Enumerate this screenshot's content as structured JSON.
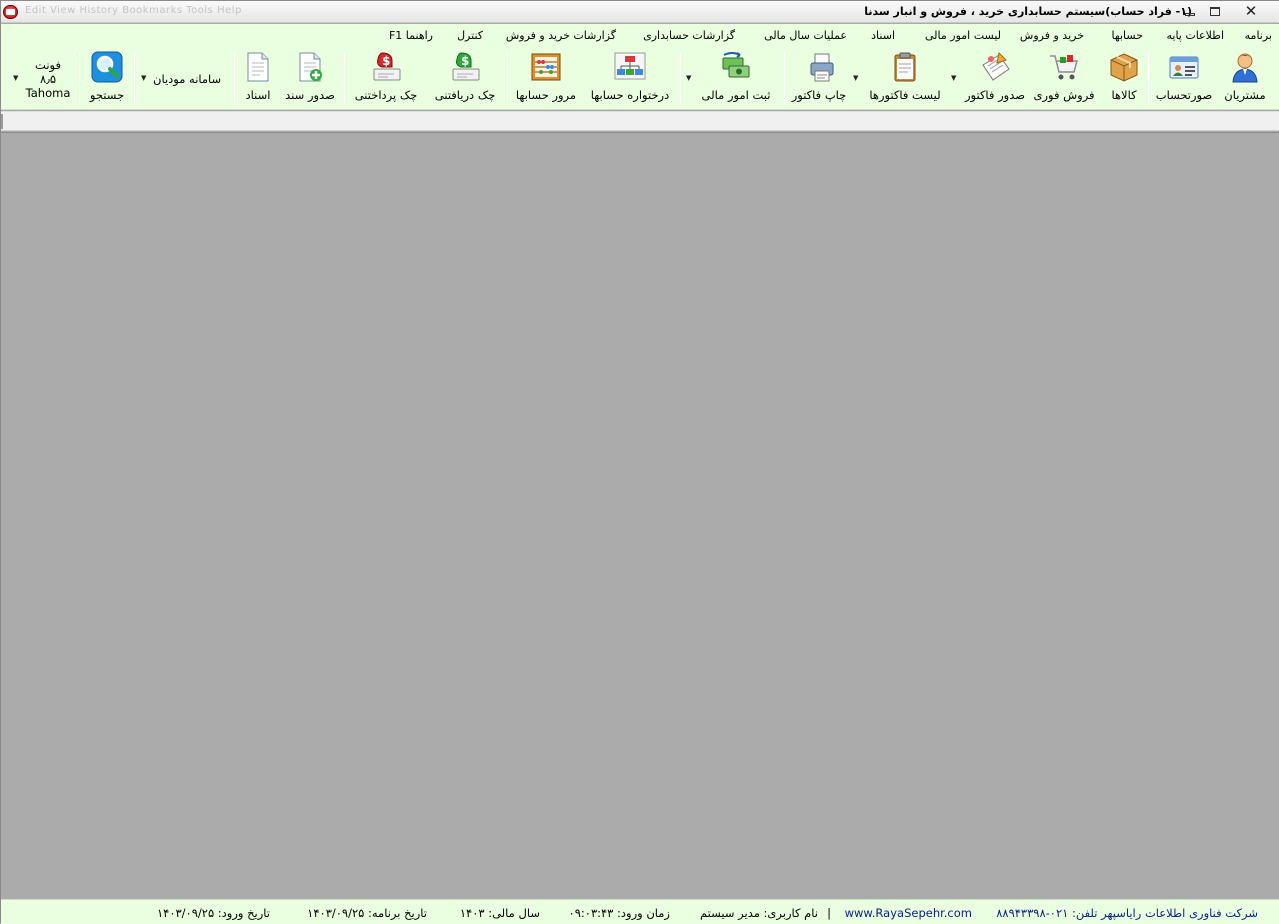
{
  "window": {
    "title": "(۱- فراد حساب)سیستم حسابداری خرید ، فروش و انبار سدنا",
    "faded_menu": "Edit  View  History  Bookmarks  Tools  Help",
    "minimize": "minimize-icon",
    "restore": "restore-icon",
    "close": "close-icon"
  },
  "menu": {
    "items": [
      "برنامه",
      "اطلاعات پایه",
      "حسابها",
      "خرید و فروش",
      "لیست امور مالی",
      "اسناد",
      "عملیات سال مالی",
      "گزارشات حسابداری",
      "گزارشات خرید و فروش",
      "کنترل",
      "راهنما F1"
    ]
  },
  "toolbar": {
    "customers": "مشتریان",
    "statement": "صورتحساب",
    "goods": "کالاها",
    "quick_sale": "فروش فوری",
    "issue_invoice": "صدور فاکتور",
    "invoice_list": "لیست فاکتورها",
    "print_invoice": "چاپ فاکتور",
    "record_finance": "ثبت امور مالی",
    "account_tree": "درختواره حسابها",
    "review_accounts": "مرور حسابها",
    "received_check": "چک دریافتنی",
    "paid_check": "چک پرداختنی",
    "issue_document": "صدور سند",
    "documents": "اسناد",
    "taxpayers": "سامانه مودیان",
    "search": "جستجو",
    "font_label": "فونت",
    "font_size": "۸٫۵",
    "font_name": "Tahoma"
  },
  "status": {
    "company": "شرکت فناوری اطلاعات رایاسپهر  تلفن: ۰۲۱-۸۸۹۴۳۳۹۸",
    "website": "www.RayaSepehr.com",
    "divider": "|",
    "username": "نام کاربری:  مدیر سیستم",
    "login_time": "زمان ورود:  ۰۹:۰۳:۴۳",
    "fiscal_year": "سال مالی:  ۱۴۰۳",
    "program_date": "تاریخ برنامه:  ۱۴۰۳/۰۹/۲۵",
    "login_date": "تاریخ ورود:  ۱۴۰۳/۰۹/۲۵"
  }
}
